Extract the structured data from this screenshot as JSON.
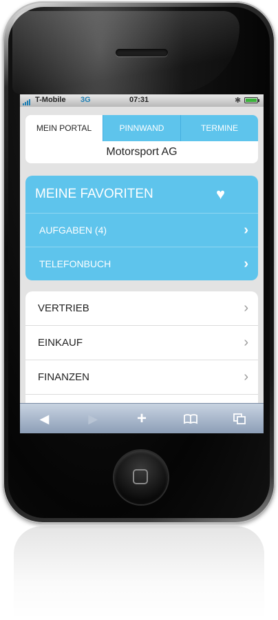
{
  "status_bar": {
    "carrier": "T-Mobile",
    "network": "3G",
    "time": "07:31",
    "bluetooth_icon": "bluetooth-icon",
    "battery_icon": "battery-icon"
  },
  "portal": {
    "tabs": [
      {
        "label": "MEIN PORTAL",
        "active": true
      },
      {
        "label": "PINNWAND",
        "active": false
      },
      {
        "label": "TERMINE",
        "active": false
      }
    ],
    "company": "Motorsport AG"
  },
  "favorites": {
    "title": "MEINE FAVORITEN",
    "icon": "heart-icon",
    "items": [
      {
        "label": "AUFGABEN (4)"
      },
      {
        "label": "TELEFONBUCH"
      }
    ]
  },
  "menu": {
    "items": [
      {
        "label": "VERTRIEB"
      },
      {
        "label": "EINKAUF"
      },
      {
        "label": "FINANZEN"
      }
    ]
  },
  "toolbar": {
    "buttons": [
      "back-icon",
      "forward-icon",
      "add-icon",
      "bookmarks-icon",
      "pages-icon"
    ]
  },
  "colors": {
    "accent": "#5ec4ec",
    "toolbar": "#8b9db6",
    "phone": "#0c0c0c"
  }
}
